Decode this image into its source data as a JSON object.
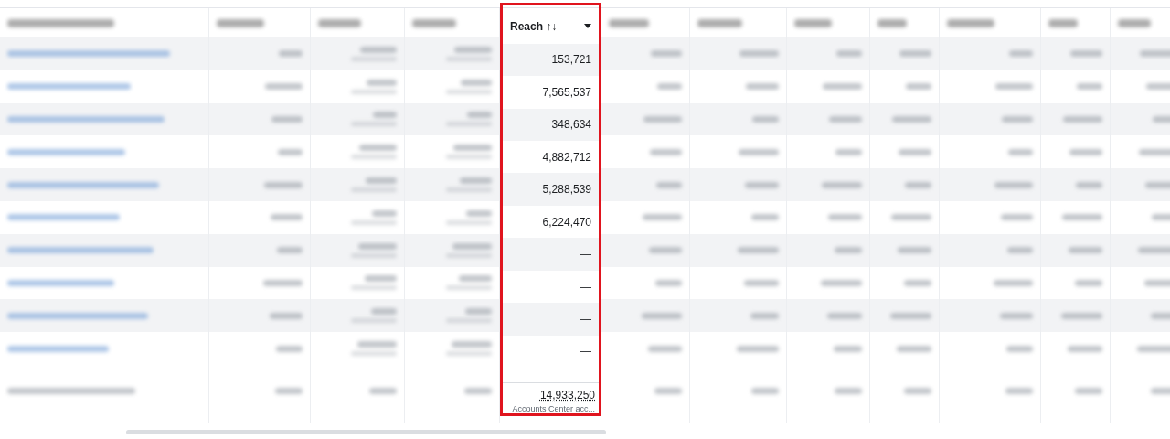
{
  "table": {
    "highlighted_column": {
      "header": {
        "label": "Reach",
        "sort_icon": "↑↓"
      },
      "rows": [
        {
          "value": "153,721"
        },
        {
          "value": "7,565,537"
        },
        {
          "value": "348,634"
        },
        {
          "value": "4,882,712"
        },
        {
          "value": "5,288,539"
        },
        {
          "value": "6,224,470"
        },
        {
          "value": "—"
        },
        {
          "value": "—"
        },
        {
          "value": "—"
        },
        {
          "value": "—"
        }
      ],
      "total": {
        "value": "14,933,250",
        "note": "Accounts Center acc..."
      }
    }
  }
}
